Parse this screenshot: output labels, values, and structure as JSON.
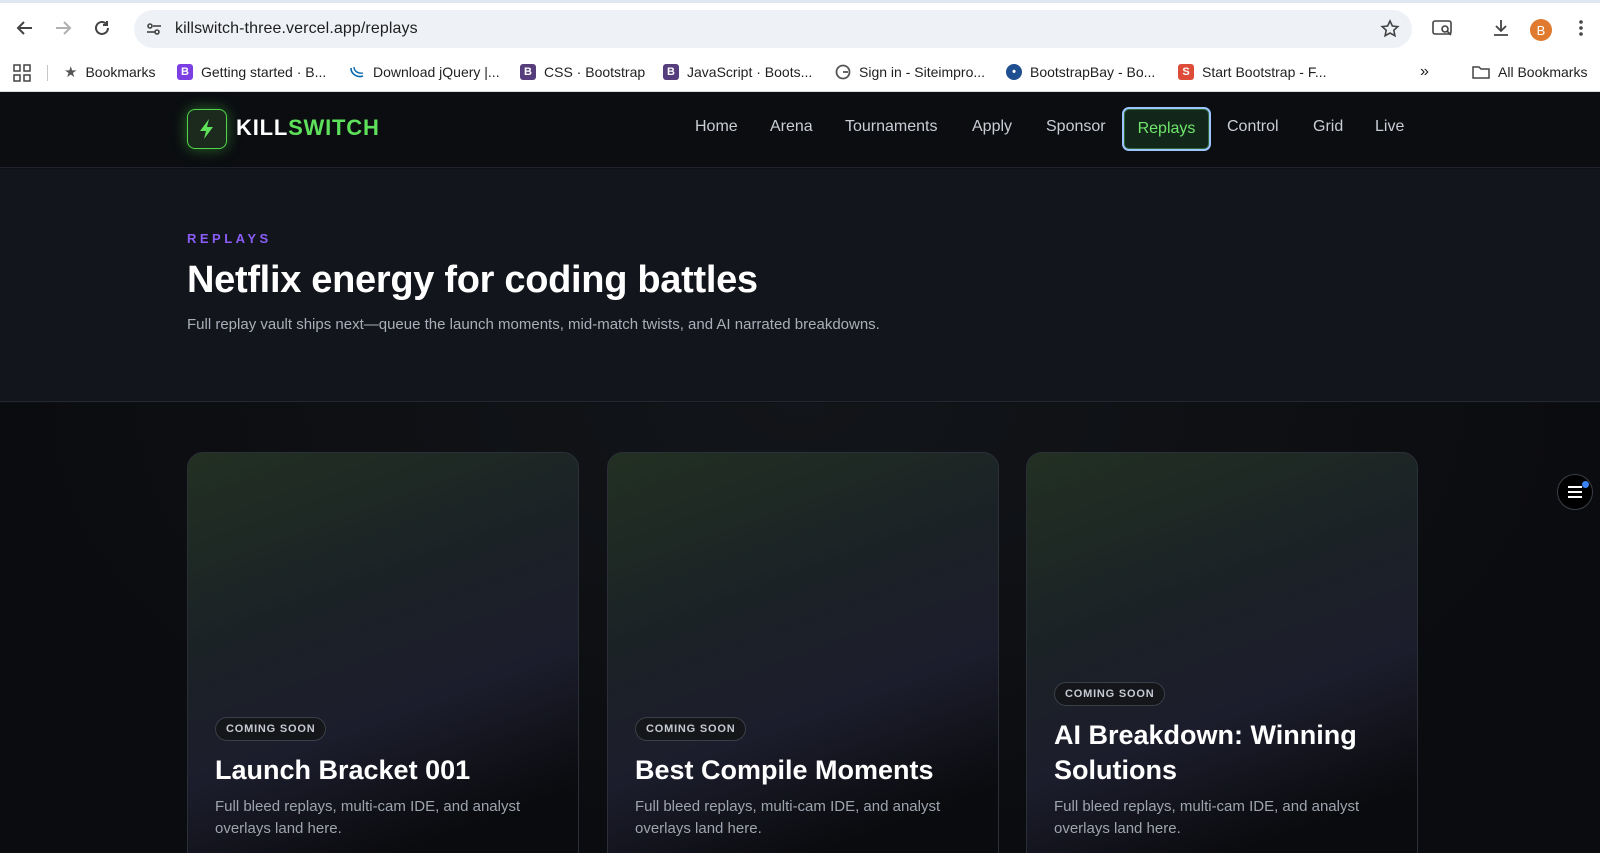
{
  "browser": {
    "url": "killswitch-three.vercel.app/replays",
    "avatar_letter": "B",
    "bookmarks": [
      {
        "label": "Bookmarks",
        "icon": "star-icon"
      },
      {
        "label": "Getting started · B...",
        "icon": "bootstrap-icon",
        "color": "#7b3fe4"
      },
      {
        "label": "Download jQuery |...",
        "icon": "jquery-icon",
        "color": "#0769ad"
      },
      {
        "label": "CSS · Bootstrap",
        "icon": "bootstrap-icon",
        "color": "#563d7c"
      },
      {
        "label": "JavaScript · Boots...",
        "icon": "bootstrap-icon",
        "color": "#563d7c"
      },
      {
        "label": "Sign in - Siteimpro...",
        "icon": "siteimprove-icon",
        "color": "#555"
      },
      {
        "label": "BootstrapBay - Bo...",
        "icon": "bootstrapbay-icon",
        "color": "#1d4f91"
      },
      {
        "label": "Start Bootstrap - F...",
        "icon": "startbootstrap-icon",
        "color": "#dd4b39"
      }
    ],
    "all_bookmarks_label": "All Bookmarks"
  },
  "site": {
    "logo": {
      "part1": "KILL",
      "part2": "SWITCH"
    },
    "nav": [
      "Home",
      "Arena",
      "Tournaments",
      "Apply",
      "Sponsor",
      "Replays",
      "Control",
      "Grid",
      "Live"
    ],
    "active_nav": "Replays"
  },
  "hero": {
    "eyebrow": "REPLAYS",
    "title": "Netflix energy for coding battles",
    "subtitle": "Full replay vault ships next—queue the launch moments, mid-match twists, and AI narrated breakdowns."
  },
  "cards": [
    {
      "badge": "COMING SOON",
      "title": "Launch Bracket 001",
      "desc": "Full bleed replays, multi-cam IDE, and analyst overlays land here."
    },
    {
      "badge": "COMING SOON",
      "title": "Best Compile Moments",
      "desc": "Full bleed replays, multi-cam IDE, and analyst overlays land here."
    },
    {
      "badge": "COMING SOON",
      "title": "AI Breakdown: Winning Solutions",
      "desc": "Full bleed replays, multi-cam IDE, and analyst overlays land here."
    }
  ],
  "colors": {
    "accent_green": "#5ee05a",
    "eyebrow_purple": "#8b5cf6",
    "background": "#0e1014"
  }
}
